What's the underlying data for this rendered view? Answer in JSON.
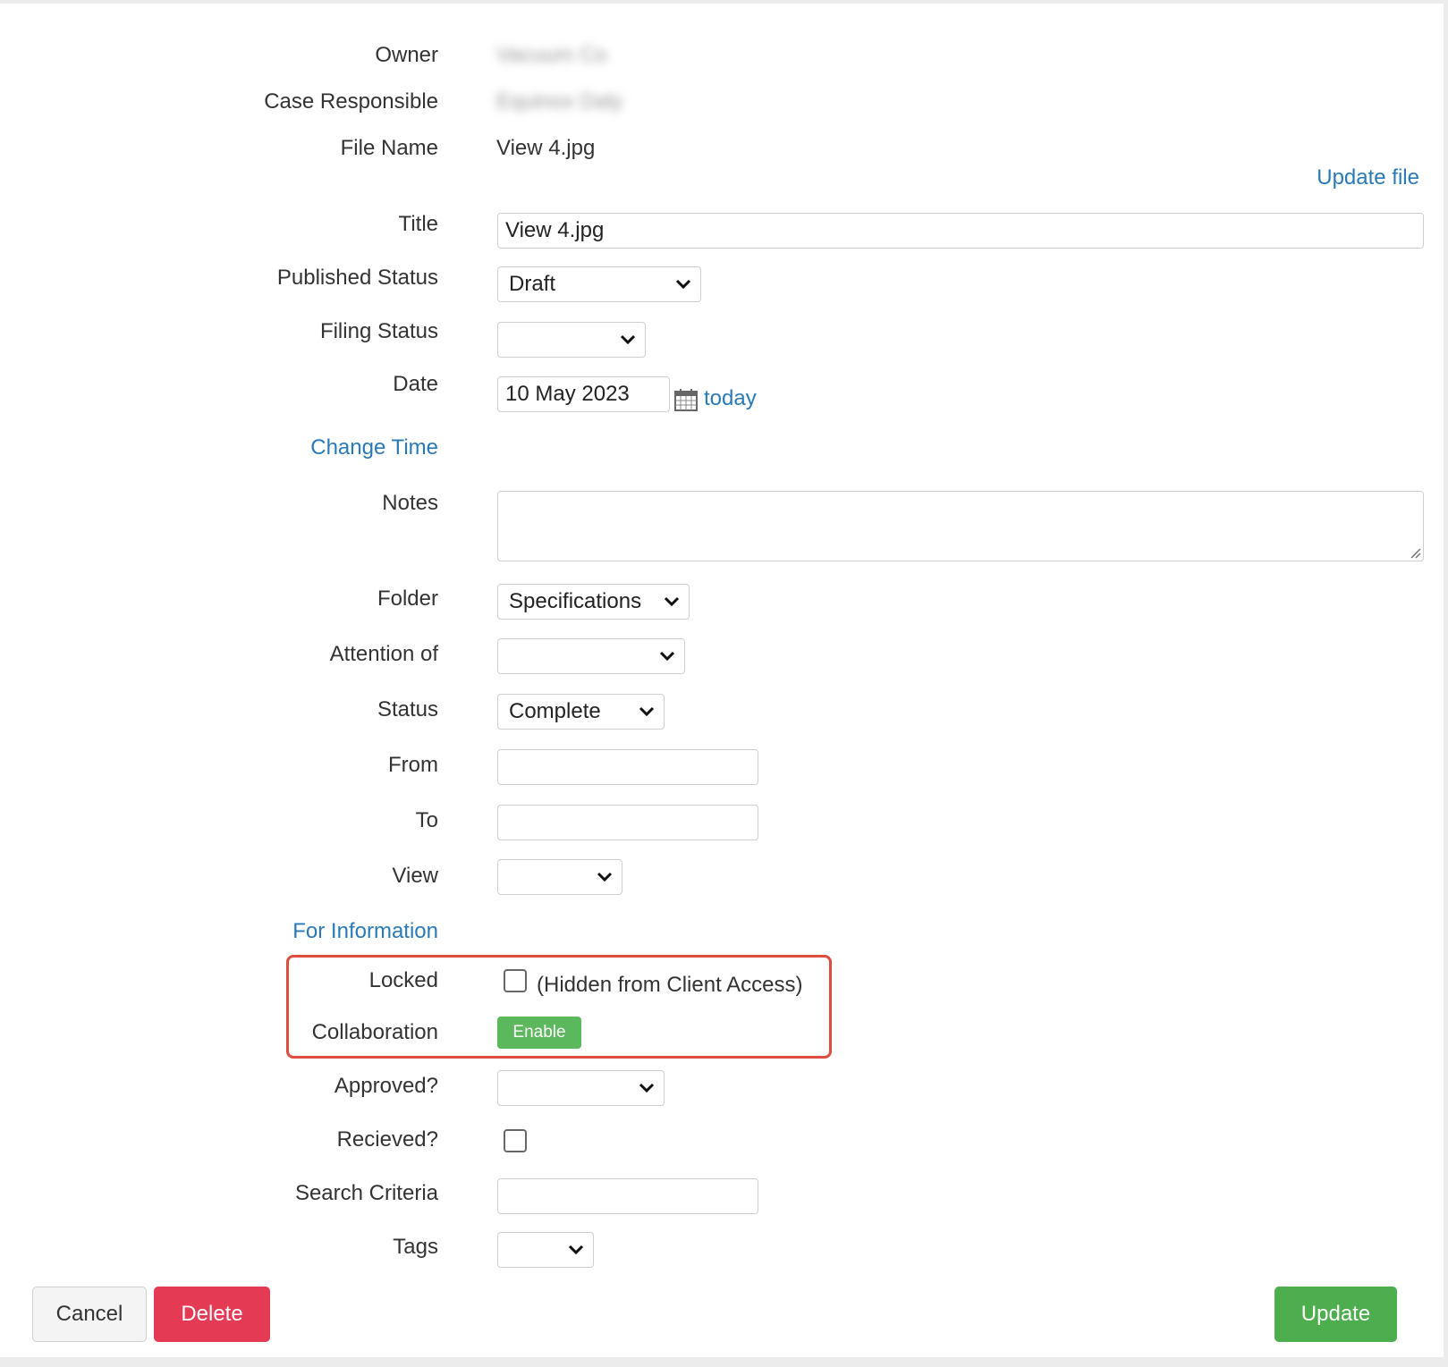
{
  "form": {
    "owner": {
      "label": "Owner",
      "value": "Vacuum Co"
    },
    "case_responsible": {
      "label": "Case Responsible",
      "value": "Equinox Daly"
    },
    "file_name": {
      "label": "File Name",
      "value": "View 4.jpg"
    },
    "update_file_link": "Update file",
    "title": {
      "label": "Title",
      "value": "View 4.jpg"
    },
    "published_status": {
      "label": "Published Status",
      "value": "Draft"
    },
    "filing_status": {
      "label": "Filing Status",
      "value": ""
    },
    "date": {
      "label": "Date",
      "value": "10 May 2023",
      "today_link": "today",
      "icon": "calendar-icon"
    },
    "change_time_link": "Change Time",
    "notes": {
      "label": "Notes",
      "value": ""
    },
    "folder": {
      "label": "Folder",
      "value": "Specifications"
    },
    "attention_of": {
      "label": "Attention of",
      "value": ""
    },
    "status": {
      "label": "Status",
      "value": "Complete"
    },
    "from": {
      "label": "From",
      "value": ""
    },
    "to": {
      "label": "To",
      "value": ""
    },
    "view": {
      "label": "View",
      "value": ""
    },
    "for_information_link": "For Information",
    "locked": {
      "label": "Locked",
      "checked": false,
      "hint": "(Hidden from Client Access)"
    },
    "collaboration": {
      "label": "Collaboration",
      "button": "Enable"
    },
    "approved": {
      "label": "Approved?",
      "value": ""
    },
    "received": {
      "label": "Recieved?",
      "checked": false
    },
    "search_criteria": {
      "label": "Search Criteria",
      "value": ""
    },
    "tags": {
      "label": "Tags",
      "value": ""
    }
  },
  "actions": {
    "cancel": "Cancel",
    "delete": "Delete",
    "update": "Update"
  },
  "colors": {
    "link": "#2a7ab8",
    "delete": "#e53a54",
    "update": "#4cae4c",
    "enable": "#5cb85c",
    "highlight": "#dd4e3f"
  }
}
